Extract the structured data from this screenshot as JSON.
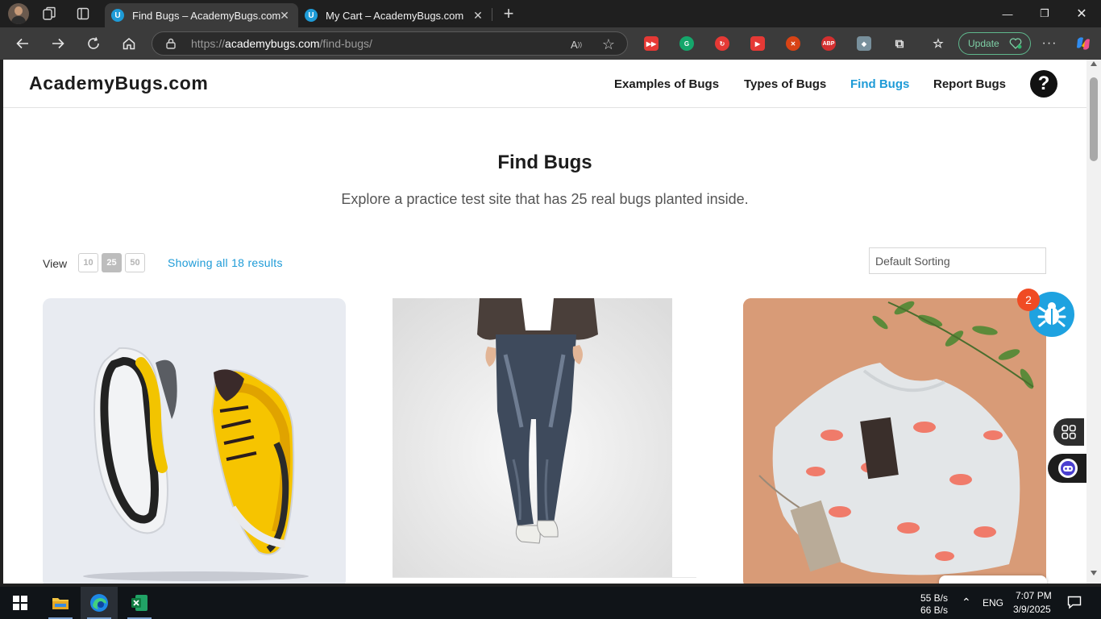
{
  "browser": {
    "tabs": [
      {
        "title": "Find Bugs – AcademyBugs.com",
        "favicon": "U",
        "active": true
      },
      {
        "title": "My Cart – AcademyBugs.com",
        "favicon": "U",
        "active": false
      }
    ],
    "url": {
      "prefix": "https://",
      "host": "academybugs.com",
      "path": "/find-bugs/"
    },
    "update_label": "Update",
    "extensions": [
      {
        "name": "media-extension-icon",
        "color": "#e53935",
        "glyph": "▶▶"
      },
      {
        "name": "grammarly-icon",
        "color": "#15a66b",
        "glyph": "G"
      },
      {
        "name": "sync-extension-icon",
        "color": "#e53935",
        "glyph": "↻"
      },
      {
        "name": "video-extension-icon",
        "color": "#e53935",
        "glyph": "▶"
      },
      {
        "name": "tools-extension-icon",
        "color": "#d84315",
        "glyph": "✕"
      },
      {
        "name": "adblock-plus-icon",
        "color": "#d32f2f",
        "glyph": "ABP"
      },
      {
        "name": "shield-extension-icon",
        "color": "#78909c",
        "glyph": "◆"
      }
    ]
  },
  "site": {
    "logo": "AcademyBugs.com",
    "nav": [
      {
        "label": "Examples of Bugs",
        "current": false
      },
      {
        "label": "Types of Bugs",
        "current": false
      },
      {
        "label": "Find Bugs",
        "current": true
      },
      {
        "label": "Report Bugs",
        "current": false
      }
    ],
    "help_glyph": "?"
  },
  "page": {
    "title": "Find Bugs",
    "subtitle": "Explore a practice test site that has 25 real bugs planted inside.",
    "view_label": "View",
    "view_options": [
      "10",
      "25",
      "50"
    ],
    "view_selected": "25",
    "results_text": "Showing all 18 results",
    "sorting_value": "Default Sorting",
    "products": [
      {
        "image": "yellow-sneakers"
      },
      {
        "image": "dark-jeans"
      },
      {
        "image": "flamingo-tshirt"
      }
    ]
  },
  "widgets": {
    "bug_count": "2"
  },
  "taskbar": {
    "net_up": "55 B/s",
    "net_down": "66 B/s",
    "language": "ENG",
    "time": "7:07 PM",
    "date": "3/9/2025"
  },
  "colors": {
    "accent": "#1e9bd7",
    "bug_widget": "#1ea2e0",
    "badge": "#f04b24"
  }
}
